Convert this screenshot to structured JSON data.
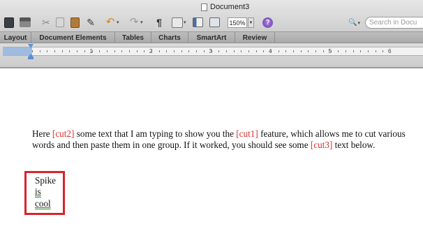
{
  "window": {
    "title": "Document3"
  },
  "toolbar": {
    "zoom_value": "150%",
    "search_placeholder": "Search in Docu",
    "icons": [
      "save-icon",
      "print-icon",
      "cut-icon",
      "copy-icon",
      "paste-icon",
      "format-painter-icon",
      "undo-icon",
      "redo-icon",
      "pilcrow-icon",
      "view-icon",
      "sidebar-icon",
      "media-browser-icon",
      "help-icon"
    ]
  },
  "ribbon": {
    "tabs": [
      "Layout",
      "Document Elements",
      "Tables",
      "Charts",
      "SmartArt",
      "Review"
    ]
  },
  "ruler": {
    "numbers": [
      "1",
      "2",
      "3",
      "4",
      "5",
      "6"
    ]
  },
  "document": {
    "para_line1_a": "Here ",
    "para_cut2": "[cut2]",
    "para_line1_b": " some text that I am typing to show you the ",
    "para_cut1": "[cut1]",
    "para_line1_c": " feature, which allows me to cut various words and then paste them in one group. If it worked, you should see some ",
    "para_cut3": "[cut3]",
    "para_line1_d": " text below.",
    "spike_lines": [
      "Spike",
      "is",
      "cool"
    ]
  },
  "colors": {
    "cut_marker": "#d8302c",
    "highlight_box": "#d9232b",
    "ruler_indent": "#5c8ed6"
  }
}
